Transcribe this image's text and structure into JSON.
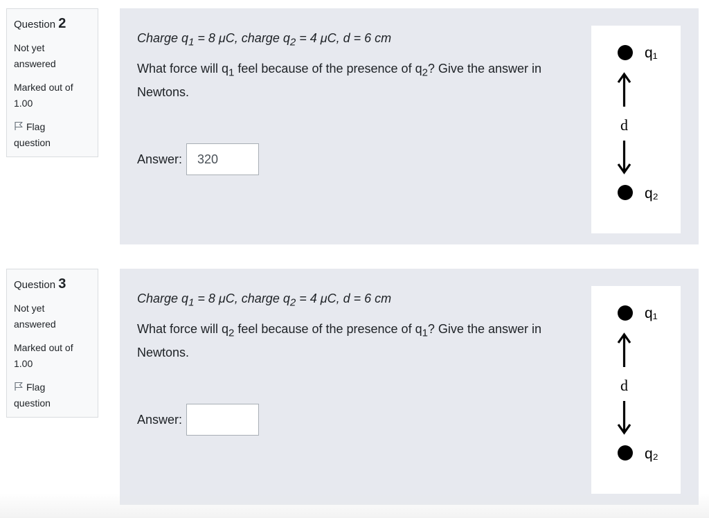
{
  "questions": [
    {
      "label": "Question",
      "number": "2",
      "state_line1": "Not yet",
      "state_line2": "answered",
      "grade_line1": "Marked out of",
      "grade_line2": "1.00",
      "flag_line1": "Flag",
      "flag_line2": "question",
      "charges": {
        "a": "Charge q",
        "a_sub": "1",
        "b": " = 8 μC, charge q",
        "b_sub": "2",
        "c": " = 4 μC, d = 6 cm"
      },
      "prompt": {
        "a": "What force will q",
        "a_sub": "1",
        "b": " feel because of the presence of q",
        "b_sub": "2",
        "c": "?  Give the answer in Newtons."
      },
      "answer_label": "Answer:",
      "answer_value": "320",
      "diagram": {
        "top_label": "q₁",
        "mid_label": "d",
        "bottom_label": "q₂"
      }
    },
    {
      "label": "Question",
      "number": "3",
      "state_line1": "Not yet",
      "state_line2": "answered",
      "grade_line1": "Marked out of",
      "grade_line2": "1.00",
      "flag_line1": "Flag",
      "flag_line2": "question",
      "charges": {
        "a": "Charge q",
        "a_sub": "1",
        "b": " = 8 μC, charge q",
        "b_sub": "2",
        "c": " = 4 μC, d = 6 cm"
      },
      "prompt": {
        "a": "What force will q",
        "a_sub": "2",
        "b": " feel because of the presence of q",
        "b_sub": "1",
        "c": "?  Give the answer in Newtons."
      },
      "answer_label": "Answer:",
      "answer_value": "",
      "diagram": {
        "top_label": "q₁",
        "mid_label": "d",
        "bottom_label": "q₂"
      }
    }
  ]
}
